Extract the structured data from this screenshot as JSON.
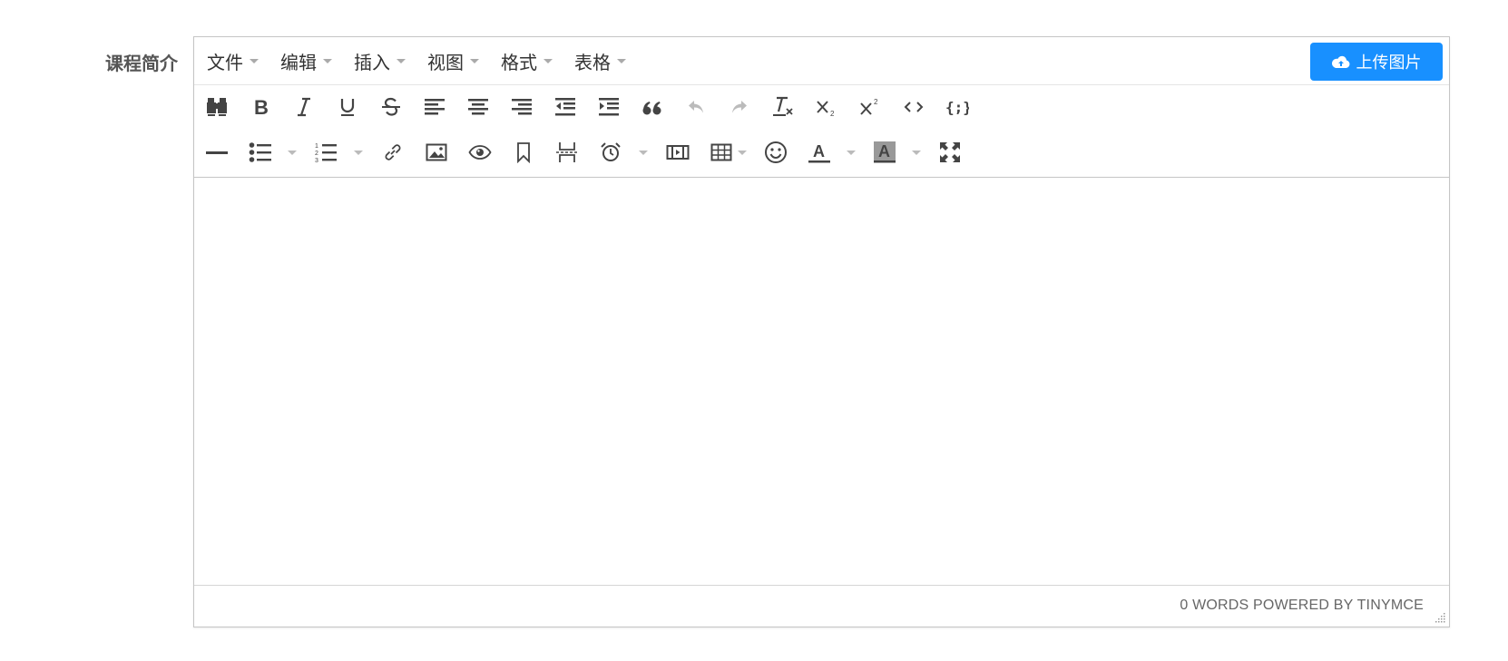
{
  "form": {
    "label": "课程简介"
  },
  "menubar": {
    "items": [
      {
        "label": "文件"
      },
      {
        "label": "编辑"
      },
      {
        "label": "插入"
      },
      {
        "label": "视图"
      },
      {
        "label": "格式"
      },
      {
        "label": "表格"
      }
    ],
    "upload_button": {
      "label": "上传图片",
      "icon": "cloud-upload-icon",
      "color": "#1890ff"
    }
  },
  "toolbar": {
    "row1": [
      "find-replace-icon",
      "bold-icon",
      "italic-icon",
      "underline-icon",
      "strikethrough-icon",
      "align-left-icon",
      "align-center-icon",
      "align-right-icon",
      "outdent-icon",
      "indent-icon",
      "blockquote-icon",
      "undo-icon",
      "redo-icon",
      "remove-format-icon",
      "subscript-icon",
      "superscript-icon",
      "code-icon",
      "code-sample-icon"
    ],
    "row2": [
      "horizontal-rule-icon",
      "bullet-list-icon",
      "numbered-list-icon",
      "link-icon",
      "image-icon",
      "preview-icon",
      "bookmark-icon",
      "page-break-icon",
      "insert-datetime-icon",
      "media-icon",
      "table-icon",
      "emoticons-icon",
      "text-color-icon",
      "background-color-icon",
      "fullscreen-icon"
    ]
  },
  "statusbar": {
    "text": "0 WORDS POWERED BY TINYMCE"
  }
}
